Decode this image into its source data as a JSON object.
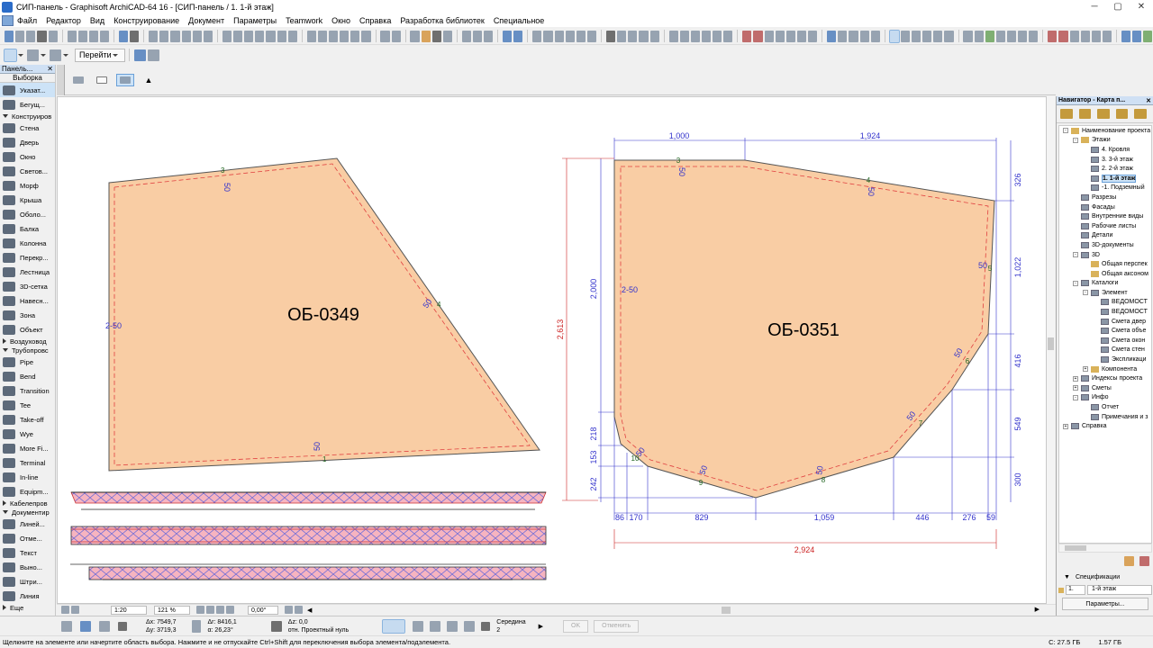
{
  "window": {
    "title": "СИП-панель - Graphisoft ArchiCAD-64 16 - [СИП-панель / 1. 1-й этаж]",
    "min": "─",
    "restore": "▢",
    "close": "✕"
  },
  "menu": [
    "Файл",
    "Редактор",
    "Вид",
    "Конструирование",
    "Документ",
    "Параметры",
    "Teamwork",
    "Окно",
    "Справка",
    "Разработка библиотек",
    "Специальное"
  ],
  "toolbar": {
    "goto_label": "Перейти"
  },
  "toolbox": {
    "title": "Панель...",
    "selection_label": "Выборка",
    "items": [
      {
        "label": "Указат...",
        "active": true
      },
      {
        "label": "Бегущ..."
      },
      {
        "group": "Конструиров",
        "open": true
      },
      {
        "label": "Стена"
      },
      {
        "label": "Дверь"
      },
      {
        "label": "Окно"
      },
      {
        "label": "Светов..."
      },
      {
        "label": "Морф"
      },
      {
        "label": "Крыша"
      },
      {
        "label": "Оболо..."
      },
      {
        "label": "Балка"
      },
      {
        "label": "Колонна"
      },
      {
        "label": "Перекр..."
      },
      {
        "label": "Лестница"
      },
      {
        "label": "3D-сетка"
      },
      {
        "label": "Навесн..."
      },
      {
        "label": "Зона"
      },
      {
        "label": "Объект"
      },
      {
        "group": "Воздуховод",
        "open": false
      },
      {
        "group": "Трубопровс",
        "open": true
      },
      {
        "label": "Pipe"
      },
      {
        "label": "Bend"
      },
      {
        "label": "Transition"
      },
      {
        "label": "Tee"
      },
      {
        "label": "Take-off"
      },
      {
        "label": "Wye"
      },
      {
        "label": "More Fi..."
      },
      {
        "label": "Terminal"
      },
      {
        "label": "In-line"
      },
      {
        "label": "Equipm..."
      },
      {
        "group": "Кабелепров",
        "open": false
      },
      {
        "group": "Документир",
        "open": true
      },
      {
        "label": "Линей..."
      },
      {
        "label": "Отме..."
      },
      {
        "label": "Текст"
      },
      {
        "label": "Выно..."
      },
      {
        "label": "Штри..."
      },
      {
        "label": "Линия"
      },
      {
        "group": "Еще",
        "open": false
      }
    ]
  },
  "drawing": {
    "panel1": {
      "label": "ОБ-0349",
      "edge_labels": [
        "50",
        "2-50",
        "50",
        "50"
      ],
      "vertex_labels": [
        "3",
        "4",
        "1"
      ]
    },
    "panel2": {
      "label": "ОБ-0351",
      "dims_top": [
        "1,000",
        "1,924"
      ],
      "dims_bottom": [
        "86",
        "170",
        "829",
        "1,059",
        "446",
        "276",
        "59"
      ],
      "dims_bottom_total": "2,924",
      "dims_left": [
        "2,000",
        "218",
        "153",
        "242"
      ],
      "dims_left_total": "2,613",
      "dims_right": [
        "326",
        "1,022",
        "416",
        "549",
        "300"
      ],
      "edge_labels": [
        "50",
        "50",
        "2-50",
        "50",
        "50",
        "50",
        "50",
        "50",
        "50"
      ],
      "vertex_labels": [
        "3",
        "4",
        "5",
        "6",
        "7",
        "8",
        "9",
        "10"
      ]
    }
  },
  "canvas_bottom": {
    "scale": "1:20",
    "zoom": "121 %",
    "angle": "0,00°"
  },
  "navigator": {
    "title": "Навигатор - Карта п...",
    "tree": [
      {
        "d": 0,
        "label": "Наименование проекта",
        "icon": "f",
        "x": "-"
      },
      {
        "d": 1,
        "label": "Этажи",
        "icon": "f",
        "x": "-"
      },
      {
        "d": 2,
        "label": "4. Кровля",
        "icon": "t"
      },
      {
        "d": 2,
        "label": "3. 3-й этаж",
        "icon": "t"
      },
      {
        "d": 2,
        "label": "2. 2-й этаж",
        "icon": "t"
      },
      {
        "d": 2,
        "label": "1. 1-й этаж",
        "icon": "t",
        "sel": true
      },
      {
        "d": 2,
        "label": "-1. Подземный",
        "icon": "t"
      },
      {
        "d": 1,
        "label": "Разрезы",
        "icon": "t"
      },
      {
        "d": 1,
        "label": "Фасады",
        "icon": "t"
      },
      {
        "d": 1,
        "label": "Внутренние виды",
        "icon": "t"
      },
      {
        "d": 1,
        "label": "Рабочие листы",
        "icon": "t"
      },
      {
        "d": 1,
        "label": "Детали",
        "icon": "t"
      },
      {
        "d": 1,
        "label": "3D-документы",
        "icon": "t"
      },
      {
        "d": 1,
        "label": "3D",
        "icon": "t",
        "x": "-"
      },
      {
        "d": 2,
        "label": "Общая перспек",
        "icon": "f"
      },
      {
        "d": 2,
        "label": "Общая аксоном",
        "icon": "f"
      },
      {
        "d": 1,
        "label": "Каталоги",
        "icon": "t",
        "x": "-"
      },
      {
        "d": 2,
        "label": "Элемент",
        "icon": "t",
        "x": "-"
      },
      {
        "d": 3,
        "label": "ВЕДОМОСТ",
        "icon": "t"
      },
      {
        "d": 3,
        "label": "ВЕДОМОСТ",
        "icon": "t"
      },
      {
        "d": 3,
        "label": "Смета двер",
        "icon": "t"
      },
      {
        "d": 3,
        "label": "Смета объе",
        "icon": "t"
      },
      {
        "d": 3,
        "label": "Смета окон",
        "icon": "t"
      },
      {
        "d": 3,
        "label": "Смета стен",
        "icon": "t"
      },
      {
        "d": 3,
        "label": "Экспликаци",
        "icon": "t"
      },
      {
        "d": 2,
        "label": "Компонента",
        "icon": "f",
        "x": "+"
      },
      {
        "d": 1,
        "label": "Индексы проекта",
        "icon": "t",
        "x": "+"
      },
      {
        "d": 1,
        "label": "Сметы",
        "icon": "t",
        "x": "+"
      },
      {
        "d": 1,
        "label": "Инфо",
        "icon": "t",
        "x": "-"
      },
      {
        "d": 2,
        "label": "Отчет",
        "icon": "t"
      },
      {
        "d": 2,
        "label": "Примечания и з",
        "icon": "t"
      },
      {
        "d": 0,
        "label": "Справка",
        "icon": "t",
        "x": "+"
      }
    ],
    "spec_title": "Спецификации",
    "spec_num": "1.",
    "spec_value": "1-й этаж",
    "params_btn": "Параметры..."
  },
  "status": {
    "dx": "Δx: 7549,7",
    "dy": "Δy: 3719,3",
    "dr": "Δr: 8416,1",
    "da": "α: 26,23°",
    "dz": "Δz: 0,0",
    "rel": "отн. Проектный нуль",
    "snap": "Середина",
    "snap_n": "2",
    "ok": "OK",
    "cancel": "Отменить"
  },
  "hint": {
    "text": "Щелкните на элементе или начертите область выбора. Нажмите и не отпускайте Ctrl+Shift для переключения выбора элемента/подэлемента.",
    "c": "C: 27.5 ГБ",
    "mem": "1.57 ГБ"
  },
  "colors": {
    "panel_fill": "#f9cda4",
    "panel_stroke": "#555555",
    "dashed": "#e04040",
    "dim": "#3333cc",
    "dim_red": "#cc2222"
  }
}
